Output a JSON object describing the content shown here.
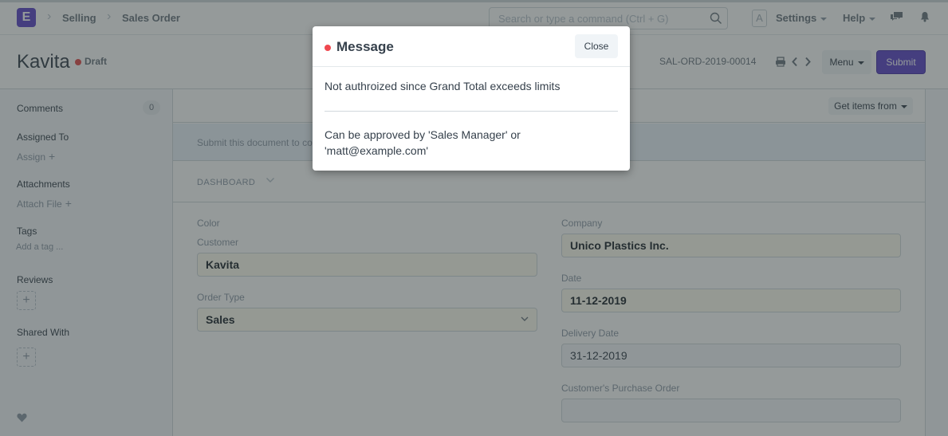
{
  "navbar": {
    "logo_letter": "E",
    "breadcrumbs": [
      "Selling",
      "Sales Order"
    ],
    "search_placeholder": "Search or type a command (Ctrl + G)",
    "avatar_letter": "A",
    "settings_label": "Settings",
    "help_label": "Help"
  },
  "page_head": {
    "title": "Kavita",
    "status": "Draft",
    "status_color": "#e24c4c",
    "doc_name": "SAL-ORD-2019-00014",
    "menu_label": "Menu",
    "submit_label": "Submit",
    "accent_color": "#5e47c9"
  },
  "sidebar": {
    "comments_label": "Comments",
    "comments_count": "0",
    "assigned_to_label": "Assigned To",
    "assign_link": "Assign",
    "attachments_label": "Attachments",
    "attach_link": "Attach File",
    "tags_label": "Tags",
    "tags_placeholder": "Add a tag ...",
    "reviews_label": "Reviews",
    "shared_with_label": "Shared With",
    "add_symbol": "+"
  },
  "form": {
    "get_items_label": "Get items from",
    "submit_hint": "Submit this document to confirm",
    "dashboard_label": "DASHBOARD",
    "fields_left": [
      {
        "label": "Color"
      },
      {
        "label": "Customer",
        "value": "Kavita"
      },
      {
        "label": "Order Type",
        "value": "Sales"
      }
    ],
    "fields_right": [
      {
        "label": "Company",
        "value": "Unico Plastics Inc."
      },
      {
        "label": "Date",
        "value": "11-12-2019"
      },
      {
        "label": "Delivery Date",
        "value": "31-12-2019"
      },
      {
        "label": "Customer's Purchase Order",
        "value": ""
      }
    ]
  },
  "modal": {
    "title": "Message",
    "indicator_color": "#f0484f",
    "close_label": "Close",
    "message_1": "Not authroized since Grand Total exceeds limits",
    "message_2_line1": "Can be approved by 'Sales Manager' or",
    "message_2_line2": "'matt@example.com'"
  }
}
